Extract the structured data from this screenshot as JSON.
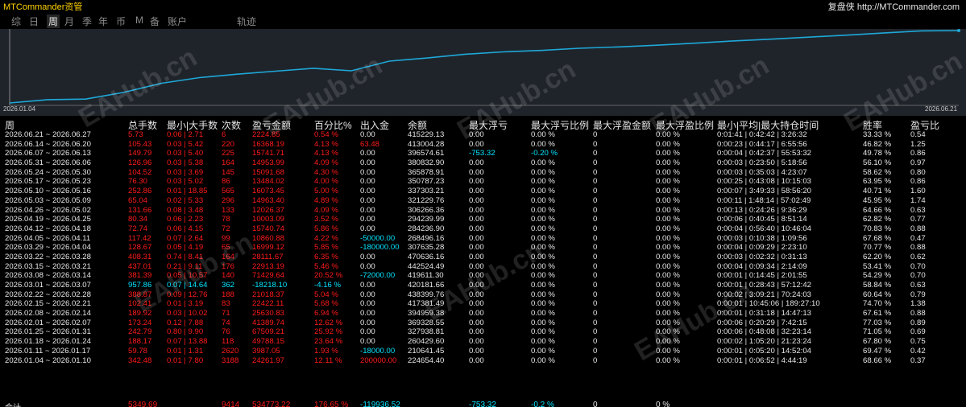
{
  "header": {
    "brand": "MTCommander资管",
    "site": "复盘侠 http://MTCommander.com"
  },
  "tabs": [
    {
      "label": "综"
    },
    {
      "label": "日"
    },
    {
      "label": "周",
      "active": true
    },
    {
      "label": "月"
    },
    {
      "label": "季"
    },
    {
      "label": "年"
    },
    {
      "label": "币"
    },
    {
      "label": "M"
    },
    {
      "label": "备"
    },
    {
      "label": "账户"
    },
    {
      "label": "轨迹"
    }
  ],
  "chart": {
    "start_label": "2026.01.04",
    "end_label": "2026.06.21",
    "line_color": "#1ea8d8"
  },
  "columns": [
    "周",
    "总手数",
    "最小|大手数",
    "次数",
    "盈亏金额",
    "百分比%",
    "出入金",
    "余额",
    "最大浮亏",
    "最大浮亏比例",
    "最大浮盈金额",
    "最大浮盈比例",
    "最小|平均|最大持仓时间",
    "胜率",
    "盈亏比"
  ],
  "rows": [
    {
      "week": "2026.06.21 ~ 2026.06.27",
      "lots": "5.73",
      "minmax": "0.06 | 2.71",
      "count": "6",
      "pnl": "2224.85",
      "pct": "0.54 %",
      "flow": "0.00",
      "balance": "415229.13",
      "maxdd": "0.00",
      "maxddpct": "0.00 %",
      "maxfp": "0",
      "maxfppct": "0.00 %",
      "hold": "0:01:41 | 0:42:42 | 3:26:32",
      "win": "33.33 %",
      "pf": "0.54"
    },
    {
      "week": "2026.06.14 ~ 2026.06.20",
      "lots": "105.43",
      "minmax": "0.03 | 5.42",
      "count": "220",
      "pnl": "16368.19",
      "pct": "4.13 %",
      "flow": "63.48",
      "balance": "413004.28",
      "maxdd": "0.00",
      "maxddpct": "0.00 %",
      "maxfp": "0",
      "maxfppct": "0.00 %",
      "hold": "0:00:23 | 0:44:17 | 6:55:56",
      "win": "46.82 %",
      "pf": "1.25"
    },
    {
      "week": "2026.06.07 ~ 2026.06.13",
      "lots": "149.79",
      "minmax": "0.03 | 5.40",
      "count": "225",
      "pnl": "15741.71",
      "pct": "4.13 %",
      "flow": "0.00",
      "balance": "396574.61",
      "maxdd": "-753.32",
      "maxddpct": "-0.20 %",
      "maxfp": "0",
      "maxfppct": "0.00 %",
      "hold": "0:00:04 | 0:42:37 | 55:53:32",
      "win": "49.78 %",
      "pf": "0.86"
    },
    {
      "week": "2026.05.31 ~ 2026.06.06",
      "lots": "126.96",
      "minmax": "0.03 | 5.38",
      "count": "164",
      "pnl": "14953.99",
      "pct": "4.09 %",
      "flow": "0.00",
      "balance": "380832.90",
      "maxdd": "0.00",
      "maxddpct": "0.00 %",
      "maxfp": "0",
      "maxfppct": "0.00 %",
      "hold": "0:00:03 | 0:23:50 | 5:18:56",
      "win": "56.10 %",
      "pf": "0.97"
    },
    {
      "week": "2026.05.24 ~ 2026.05.30",
      "lots": "104.52",
      "minmax": "0.03 | 3.69",
      "count": "145",
      "pnl": "15091.68",
      "pct": "4.30 %",
      "flow": "0.00",
      "balance": "365878.91",
      "maxdd": "0.00",
      "maxddpct": "0.00 %",
      "maxfp": "0",
      "maxfppct": "0.00 %",
      "hold": "0:00:03 | 0:35:03 | 4:23:07",
      "win": "58.62 %",
      "pf": "0.80"
    },
    {
      "week": "2026.05.17 ~ 2026.05.23",
      "lots": "76.30",
      "minmax": "0.03 | 5.02",
      "count": "86",
      "pnl": "13484.02",
      "pct": "4.00 %",
      "flow": "0.00",
      "balance": "350787.23",
      "maxdd": "0.00",
      "maxddpct": "0.00 %",
      "maxfp": "0",
      "maxfppct": "0.00 %",
      "hold": "0:00:25 | 0:43:08 | 10:15:03",
      "win": "63.95 %",
      "pf": "0.86"
    },
    {
      "week": "2026.05.10 ~ 2026.05.16",
      "lots": "252.86",
      "minmax": "0.01 | 18.85",
      "count": "565",
      "pnl": "16073.45",
      "pct": "5.00 %",
      "flow": "0.00",
      "balance": "337303.21",
      "maxdd": "0.00",
      "maxddpct": "0.00 %",
      "maxfp": "0",
      "maxfppct": "0.00 %",
      "hold": "0:00:07 | 3:49:33 | 58:56:20",
      "win": "40.71 %",
      "pf": "1.60"
    },
    {
      "week": "2026.05.03 ~ 2026.05.09",
      "lots": "65.04",
      "minmax": "0.02 | 5.33",
      "count": "296",
      "pnl": "14963.40",
      "pct": "4.89 %",
      "flow": "0.00",
      "balance": "321229.76",
      "maxdd": "0.00",
      "maxddpct": "0.00 %",
      "maxfp": "0",
      "maxfppct": "0.00 %",
      "hold": "0:00:11 | 1:48:14 | 57:02:49",
      "win": "45.95 %",
      "pf": "1.74"
    },
    {
      "week": "2026.04.26 ~ 2026.05.02",
      "lots": "131.66",
      "minmax": "0.08 | 3.48",
      "count": "133",
      "pnl": "12026.37",
      "pct": "4.09 %",
      "flow": "0.00",
      "balance": "306266.36",
      "maxdd": "0.00",
      "maxddpct": "0.00 %",
      "maxfp": "0",
      "maxfppct": "0.00 %",
      "hold": "0:00:13 | 0:24:26 | 9:36:29",
      "win": "64.66 %",
      "pf": "0.63"
    },
    {
      "week": "2026.04.19 ~ 2026.04.25",
      "lots": "80.34",
      "minmax": "0.06 | 2.23",
      "count": "78",
      "pnl": "10003.09",
      "pct": "3.52 %",
      "flow": "0.00",
      "balance": "294239.99",
      "maxdd": "0.00",
      "maxddpct": "0.00 %",
      "maxfp": "0",
      "maxfppct": "0.00 %",
      "hold": "0:00:06 | 0:40:45 | 8:51:14",
      "win": "62.82 %",
      "pf": "0.77"
    },
    {
      "week": "2026.04.12 ~ 2026.04.18",
      "lots": "72.74",
      "minmax": "0.06 | 4.15",
      "count": "72",
      "pnl": "15740.74",
      "pct": "5.86 %",
      "flow": "0.00",
      "balance": "284236.90",
      "maxdd": "0.00",
      "maxddpct": "0.00 %",
      "maxfp": "0",
      "maxfppct": "0.00 %",
      "hold": "0:00:04 | 0:56:40 | 10:46:04",
      "win": "70.83 %",
      "pf": "0.88"
    },
    {
      "week": "2026.04.05 ~ 2026.04.11",
      "lots": "117.42",
      "minmax": "0.07 | 2.64",
      "count": "99",
      "pnl": "10860.88",
      "pct": "4.22 %",
      "flow": "-50000.00",
      "balance": "268496.16",
      "maxdd": "0.00",
      "maxddpct": "0.00 %",
      "maxfp": "0",
      "maxfppct": "0.00 %",
      "hold": "0:00:03 | 0:10:38 | 1:09:56",
      "win": "67.68 %",
      "pf": "0.47"
    },
    {
      "week": "2026.03.29 ~ 2026.04.04",
      "lots": "128.67",
      "minmax": "0.05 | 4.19",
      "count": "65",
      "pnl": "16999.12",
      "pct": "5.85 %",
      "flow": "-180000.00",
      "balance": "307635.28",
      "maxdd": "0.00",
      "maxddpct": "0.00 %",
      "maxfp": "0",
      "maxfppct": "0.00 %",
      "hold": "0:00:04 | 0:09:29 | 2:23:10",
      "win": "70.77 %",
      "pf": "0.88"
    },
    {
      "week": "2026.03.22 ~ 2026.03.28",
      "lots": "408.31",
      "minmax": "0.74 | 8.41",
      "count": "164",
      "pnl": "28111.67",
      "pct": "6.35 %",
      "flow": "0.00",
      "balance": "470636.16",
      "maxdd": "0.00",
      "maxddpct": "0.00 %",
      "maxfp": "0",
      "maxfppct": "0.00 %",
      "hold": "0:00:03 | 0:02:32 | 0:31:13",
      "win": "62.20 %",
      "pf": "0.62"
    },
    {
      "week": "2026.03.15 ~ 2026.03.21",
      "lots": "437.01",
      "minmax": "0.21 | 9.11",
      "count": "176",
      "pnl": "22913.19",
      "pct": "5.46 %",
      "flow": "0.00",
      "balance": "442524.49",
      "maxdd": "0.00",
      "maxddpct": "0.00 %",
      "maxfp": "0",
      "maxfppct": "0.00 %",
      "hold": "0:00:04 | 0:09:34 | 2:14:09",
      "win": "53.41 %",
      "pf": "0.70"
    },
    {
      "week": "2026.03.08 ~ 2026.03.14",
      "lots": "381.39",
      "minmax": "0.05 | 10.57",
      "count": "140",
      "pnl": "71429.64",
      "pct": "20.52 %",
      "flow": "-72000.00",
      "balance": "419611.30",
      "maxdd": "0.00",
      "maxddpct": "0.00 %",
      "maxfp": "0",
      "maxfppct": "0.00 %",
      "hold": "0:00:01 | 0:14:45 | 2:01:55",
      "win": "54.29 %",
      "pf": "0.70"
    },
    {
      "week": "2026.03.01 ~ 2026.03.07",
      "lots": "957.86",
      "minmax": "0.07 | 14.64",
      "count": "362",
      "pnl": "-18218.10",
      "pct": "-4.16 %",
      "flow": "0.00",
      "balance": "420181.66",
      "maxdd": "0.00",
      "maxddpct": "0.00 %",
      "maxfp": "0",
      "maxfppct": "0.00 %",
      "hold": "0:00:01 | 0:28:43 | 57:12:42",
      "win": "58.84 %",
      "pf": "0.63",
      "neg": true
    },
    {
      "week": "2026.02.22 ~ 2026.02.28",
      "lots": "388.87",
      "minmax": "0.09 | 12.76",
      "count": "188",
      "pnl": "21018.37",
      "pct": "5.04 %",
      "flow": "0.00",
      "balance": "438399.76",
      "maxdd": "0.00",
      "maxddpct": "0.00 %",
      "maxfp": "0",
      "maxfppct": "0.00 %",
      "hold": "0:00:02 | 3:09:21 | 70:24:03",
      "win": "60.64 %",
      "pf": "0.79"
    },
    {
      "week": "2026.02.15 ~ 2026.02.21",
      "lots": "102.41",
      "minmax": "0.01 | 3.19",
      "count": "83",
      "pnl": "22422.11",
      "pct": "5.68 %",
      "flow": "0.00",
      "balance": "417381.49",
      "maxdd": "0.00",
      "maxddpct": "0.00 %",
      "maxfp": "0",
      "maxfppct": "0.00 %",
      "hold": "0:00:01 | 10:45:06 | 189:27:10",
      "win": "74.70 %",
      "pf": "1.38"
    },
    {
      "week": "2026.02.08 ~ 2026.02.14",
      "lots": "189.92",
      "minmax": "0.03 | 10.02",
      "count": "71",
      "pnl": "25630.83",
      "pct": "6.94 %",
      "flow": "0.00",
      "balance": "394959.38",
      "maxdd": "0.00",
      "maxddpct": "0.00 %",
      "maxfp": "0",
      "maxfppct": "0.00 %",
      "hold": "0:00:01 | 0:31:18 | 14:47:13",
      "win": "67.61 %",
      "pf": "0.88"
    },
    {
      "week": "2026.02.01 ~ 2026.02.07",
      "lots": "173.24",
      "minmax": "0.12 | 7.88",
      "count": "74",
      "pnl": "41389.74",
      "pct": "12.62 %",
      "flow": "0.00",
      "balance": "369328.55",
      "maxdd": "0.00",
      "maxddpct": "0.00 %",
      "maxfp": "0",
      "maxfppct": "0.00 %",
      "hold": "0:00:06 | 0:20:29 | 7:42:15",
      "win": "77.03 %",
      "pf": "0.89"
    },
    {
      "week": "2026.01.25 ~ 2026.01.31",
      "lots": "242.79",
      "minmax": "0.80 | 9.90",
      "count": "76",
      "pnl": "67509.21",
      "pct": "25.92 %",
      "flow": "0.00",
      "balance": "327938.81",
      "maxdd": "0.00",
      "maxddpct": "0.00 %",
      "maxfp": "0",
      "maxfppct": "0.00 %",
      "hold": "0:00:06 | 0:48:08 | 32:23:14",
      "win": "71.05 %",
      "pf": "0.69"
    },
    {
      "week": "2026.01.18 ~ 2026.01.24",
      "lots": "188.17",
      "minmax": "0.07 | 13.88",
      "count": "118",
      "pnl": "49788.15",
      "pct": "23.64 %",
      "flow": "0.00",
      "balance": "260429.60",
      "maxdd": "0.00",
      "maxddpct": "0.00 %",
      "maxfp": "0",
      "maxfppct": "0.00 %",
      "hold": "0:00:02 | 1:05:20 | 21:23:24",
      "win": "67.80 %",
      "pf": "0.75"
    },
    {
      "week": "2026.01.11 ~ 2026.01.17",
      "lots": "59.78",
      "minmax": "0.01 | 1.31",
      "count": "2620",
      "pnl": "3987.05",
      "pct": "1.93 %",
      "flow": "-18000.00",
      "balance": "210641.45",
      "maxdd": "0.00",
      "maxddpct": "0.00 %",
      "maxfp": "0",
      "maxfppct": "0.00 %",
      "hold": "0:00:01 | 0:05:20 | 14:52:04",
      "win": "69.47 %",
      "pf": "0.42"
    },
    {
      "week": "2026.01.04 ~ 2026.01.10",
      "lots": "342.48",
      "minmax": "0.01 | 7.80",
      "count": "3188",
      "pnl": "24261.97",
      "pct": "12.11 %",
      "flow": "200000.00",
      "balance": "224654.40",
      "maxdd": "0.00",
      "maxddpct": "0.00 %",
      "maxfp": "0",
      "maxfppct": "0.00 %",
      "hold": "0:00:01 | 0:06:52 | 4:44:19",
      "win": "68.66 %",
      "pf": "0.37"
    }
  ],
  "total": {
    "label": "合计",
    "lots": "5349.69",
    "count": "9414",
    "pnl": "534773.22",
    "pct": "176.65 %",
    "flow": "-119936.52",
    "maxdd": "-753.32",
    "maxddpct": "-0.2 %",
    "maxfp": "0",
    "maxfppct": "0 %"
  },
  "watermark": "EAHub.cn",
  "colors": {
    "positive": "#ff1a1a",
    "negative": "#00e5ff",
    "text": "#e6e6e6",
    "brand": "#ffd200",
    "chart_bg": "#1f242b"
  }
}
